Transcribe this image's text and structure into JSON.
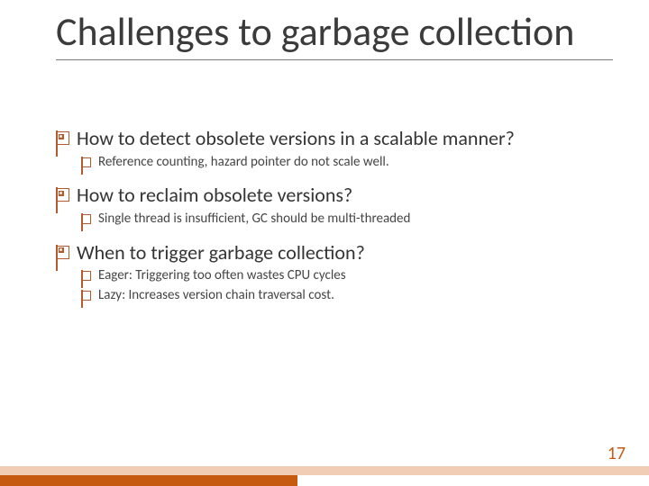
{
  "accent_color": "#c65a11",
  "title": "Challenges to garbage collection",
  "page_number": "17",
  "bullets": [
    {
      "text": "How to detect obsolete versions in a scalable manner?",
      "children": [
        "Reference counting, hazard pointer do not scale well."
      ]
    },
    {
      "text": "How to reclaim obsolete versions?",
      "children": [
        "Single thread is insufficient, GC should be multi-threaded"
      ]
    },
    {
      "text": "When to trigger garbage collection?",
      "children": [
        "Eager: Triggering too often wastes CPU cycles",
        "Lazy: Increases version chain traversal cost."
      ]
    }
  ]
}
